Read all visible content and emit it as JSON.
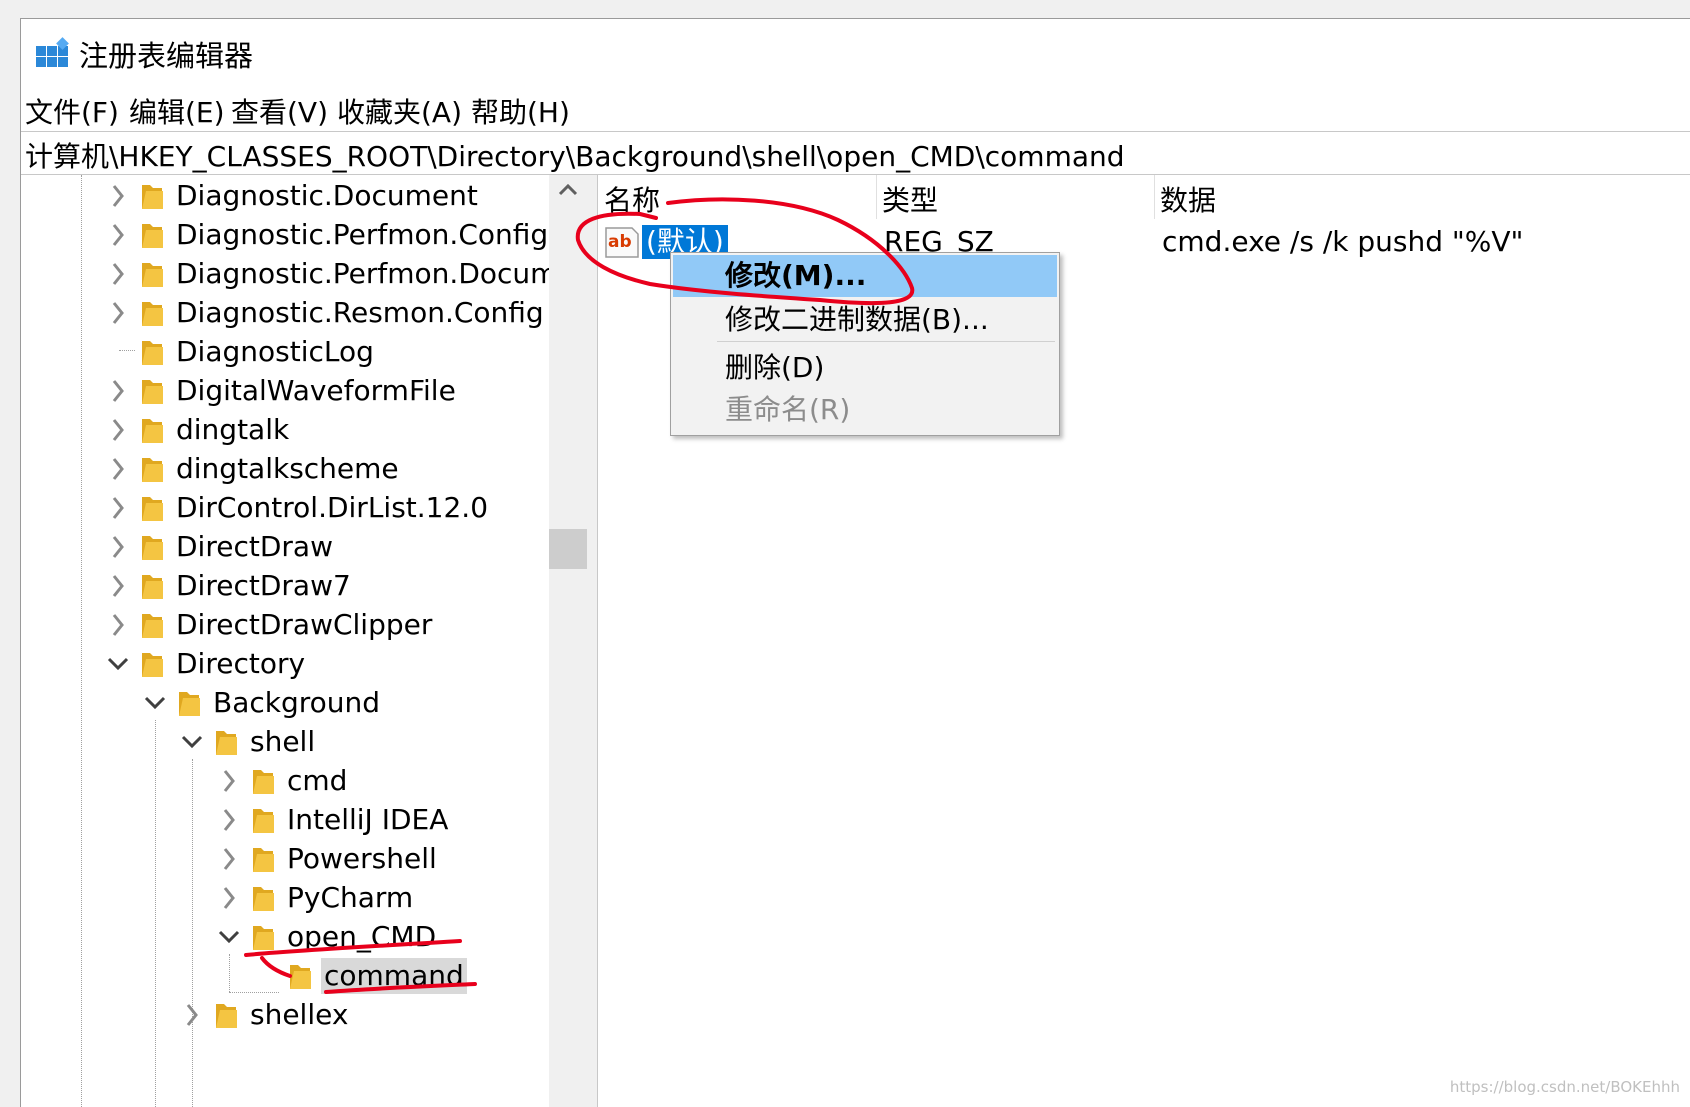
{
  "window": {
    "title": "注册表编辑器"
  },
  "menu": [
    "文件(F)",
    "编辑(E)",
    "查看(V)",
    "收藏夹(A)",
    "帮助(H)"
  ],
  "address": "计算机\\HKEY_CLASSES_ROOT\\Directory\\Background\\shell\\open_CMD\\command",
  "tree": [
    {
      "label": "Diagnostic.Document",
      "level": 0,
      "chevron": "right"
    },
    {
      "label": "Diagnostic.Perfmon.Config",
      "level": 0,
      "chevron": "right"
    },
    {
      "label": "Diagnostic.Perfmon.Document",
      "level": 0,
      "chevron": "right"
    },
    {
      "label": "Diagnostic.Resmon.Config",
      "level": 0,
      "chevron": "right"
    },
    {
      "label": "DiagnosticLog",
      "level": 0,
      "chevron": "none"
    },
    {
      "label": "DigitalWaveformFile",
      "level": 0,
      "chevron": "right"
    },
    {
      "label": "dingtalk",
      "level": 0,
      "chevron": "right"
    },
    {
      "label": "dingtalkscheme",
      "level": 0,
      "chevron": "right"
    },
    {
      "label": "DirControl.DirList.12.0",
      "level": 0,
      "chevron": "right"
    },
    {
      "label": "DirectDraw",
      "level": 0,
      "chevron": "right"
    },
    {
      "label": "DirectDraw7",
      "level": 0,
      "chevron": "right"
    },
    {
      "label": "DirectDrawClipper",
      "level": 0,
      "chevron": "right"
    },
    {
      "label": "Directory",
      "level": 0,
      "chevron": "down"
    },
    {
      "label": "Background",
      "level": 1,
      "chevron": "down"
    },
    {
      "label": "shell",
      "level": 2,
      "chevron": "down"
    },
    {
      "label": "cmd",
      "level": 3,
      "chevron": "right"
    },
    {
      "label": "IntelliJ IDEA",
      "level": 3,
      "chevron": "right"
    },
    {
      "label": "Powershell",
      "level": 3,
      "chevron": "right"
    },
    {
      "label": "PyCharm",
      "level": 3,
      "chevron": "right"
    },
    {
      "label": "open_CMD",
      "level": 3,
      "chevron": "down"
    },
    {
      "label": "command",
      "level": 4,
      "chevron": "none",
      "selected": true
    },
    {
      "label": "shellex",
      "level": 2,
      "chevron": "right"
    }
  ],
  "list": {
    "headers": {
      "name": "名称",
      "type": "类型",
      "data": "数据"
    },
    "rows": [
      {
        "icon": "ab",
        "name": "(默认)",
        "type": "REG_SZ",
        "data": "cmd.exe /s /k pushd \"%V\""
      }
    ]
  },
  "context_menu": [
    {
      "label": "修改(M)...",
      "state": "hover",
      "bold": true
    },
    {
      "label": "修改二进制数据(B)...",
      "state": "normal"
    },
    {
      "label": "删除(D)",
      "state": "normal"
    },
    {
      "label": "重命名(R)",
      "state": "disabled"
    }
  ],
  "watermark": "https://blog.csdn.net/BOKEhhh",
  "colors": {
    "selection": "#0078d7",
    "menu_hover": "#91c9f7",
    "annotation": "#e8001c",
    "folder": "#f4c542"
  }
}
